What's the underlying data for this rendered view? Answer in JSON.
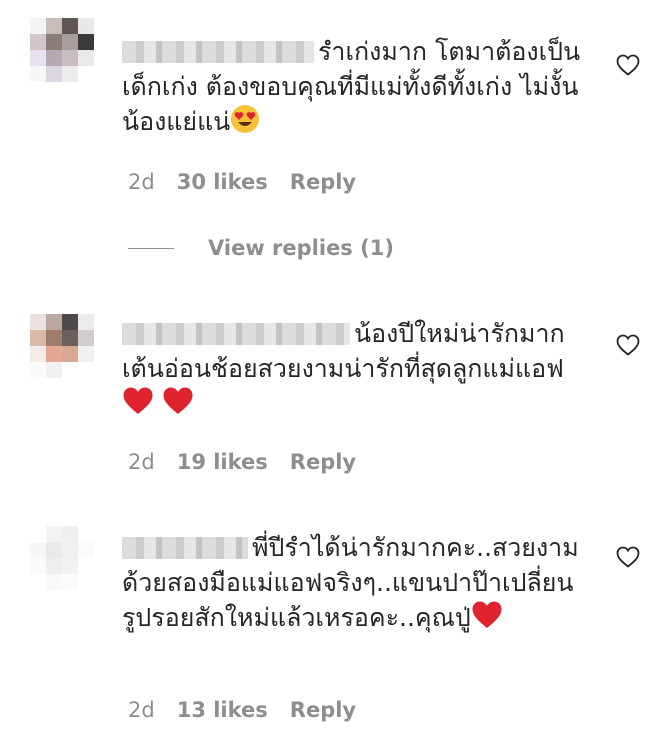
{
  "comments": [
    {
      "text": "รำเก่งมาก โตมาต้องเป็นเด็กเก่ง ต้องขอบคุณที่มีแม่ทั้งดีทั้งเก่ง ไม่งั้นน้องแย่แน่",
      "emoji": "heart-eyes-emoji",
      "age": "2d",
      "likes": "30 likes",
      "reply": "Reply",
      "view_replies": "View replies (1)"
    },
    {
      "text": "น้องปีใหม่น่ารักมากเต้นอ่อนช้อยสวยงามน่ารักที่สุดลูกแม่แอฟ",
      "emoji": "red-heart-emoji x2",
      "age": "2d",
      "likes": "19 likes",
      "reply": "Reply"
    },
    {
      "text": "พี่ปีรำได้น่ารักมากคะ..สวยงามด้วยสองมือแม่แอฟจริงๆ..แขนปาป๊าเปลี่ยนรูปรอยสักใหม่แล้วเหรอคะ..คุณปู่",
      "emoji": "red-heart-emoji",
      "age": "2d",
      "likes": "13 likes",
      "reply": "Reply"
    }
  ],
  "colors": {
    "text": "#262626",
    "muted": "#8e8e8e",
    "heart_red": "#e0242f"
  }
}
